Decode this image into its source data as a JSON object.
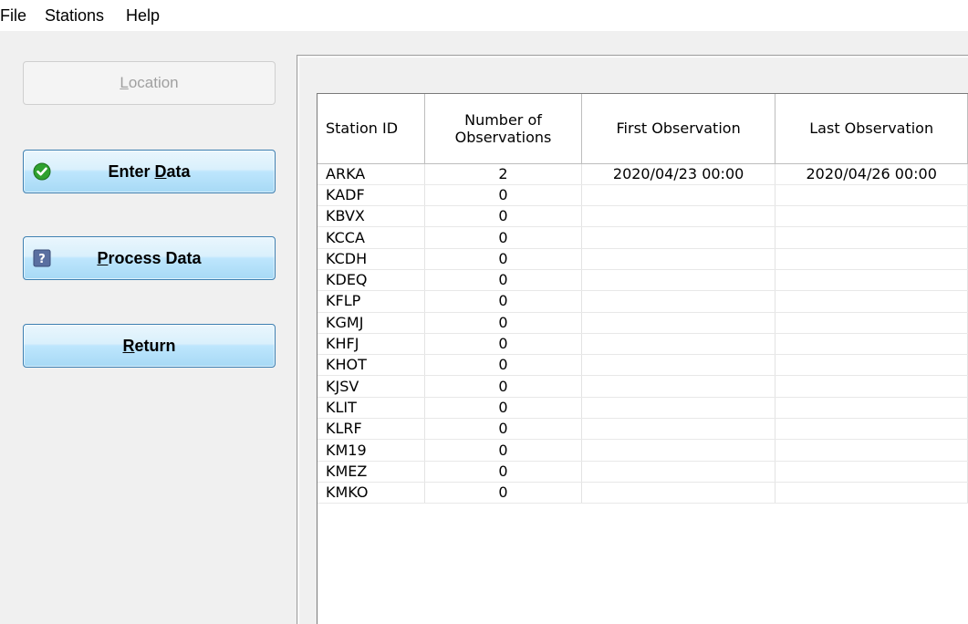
{
  "menu": {
    "items": [
      "File",
      "Stations",
      "Help"
    ]
  },
  "buttons": {
    "location": {
      "label": "Location",
      "accel": "L",
      "rest": "ocation",
      "enabled": false
    },
    "enter_data": {
      "accel_pre": "Enter ",
      "accel": "D",
      "rest": "ata",
      "icon": "green-check-icon"
    },
    "process_data": {
      "accel_pre": "",
      "accel": "P",
      "rest": "rocess Data",
      "icon": "help-question-icon"
    },
    "return": {
      "accel_pre": "",
      "accel": "R",
      "rest": "eturn"
    }
  },
  "colors": {
    "button_border": "#3c7fb1",
    "button_fill": "#bee6fd",
    "check_green": "#2fa12f",
    "help_icon": "#5a6fa0"
  },
  "table": {
    "headers": {
      "station_id": "Station ID",
      "num_obs_line1": "Number of",
      "num_obs_line2": "Observations",
      "first_obs": "First Observation",
      "last_obs": "Last Observation"
    },
    "rows": [
      {
        "id": "ARKA",
        "count": "2",
        "first": "2020/04/23 00:00",
        "last": "2020/04/26 00:00"
      },
      {
        "id": "KADF",
        "count": "0",
        "first": "",
        "last": ""
      },
      {
        "id": "KBVX",
        "count": "0",
        "first": "",
        "last": ""
      },
      {
        "id": "KCCA",
        "count": "0",
        "first": "",
        "last": ""
      },
      {
        "id": "KCDH",
        "count": "0",
        "first": "",
        "last": ""
      },
      {
        "id": "KDEQ",
        "count": "0",
        "first": "",
        "last": ""
      },
      {
        "id": "KFLP",
        "count": "0",
        "first": "",
        "last": ""
      },
      {
        "id": "KGMJ",
        "count": "0",
        "first": "",
        "last": ""
      },
      {
        "id": "KHFJ",
        "count": "0",
        "first": "",
        "last": ""
      },
      {
        "id": "KHOT",
        "count": "0",
        "first": "",
        "last": ""
      },
      {
        "id": "KJSV",
        "count": "0",
        "first": "",
        "last": ""
      },
      {
        "id": "KLIT",
        "count": "0",
        "first": "",
        "last": ""
      },
      {
        "id": "KLRF",
        "count": "0",
        "first": "",
        "last": ""
      },
      {
        "id": "KM19",
        "count": "0",
        "first": "",
        "last": ""
      },
      {
        "id": "KMEZ",
        "count": "0",
        "first": "",
        "last": ""
      },
      {
        "id": "KMKO",
        "count": "0",
        "first": "",
        "last": ""
      }
    ]
  }
}
